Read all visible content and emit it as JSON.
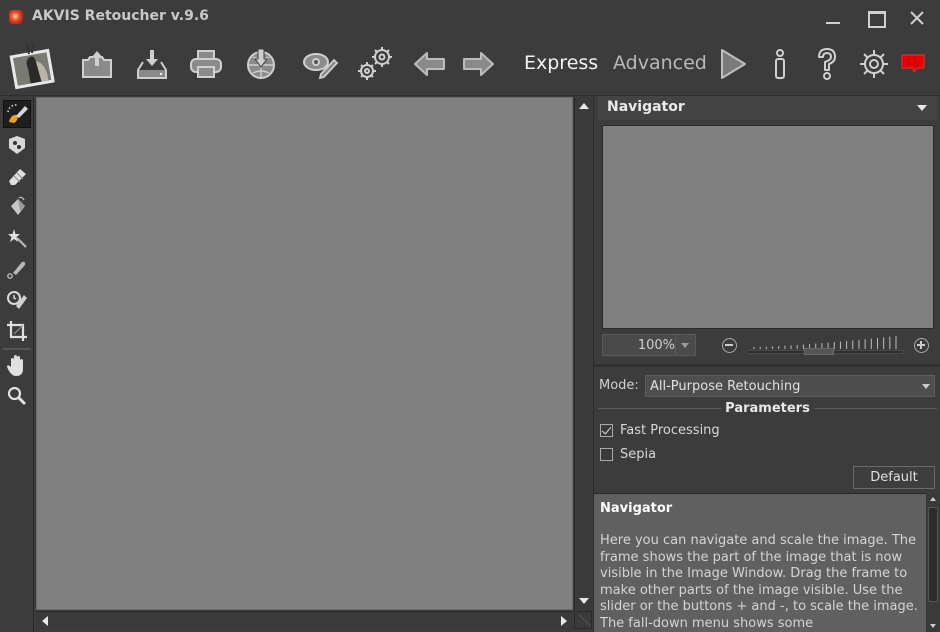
{
  "window": {
    "title": "AKVIS Retoucher v.9.6",
    "controls": {
      "minimize": "minimize-icon",
      "maximize": "maximize-icon",
      "close": "close-icon"
    }
  },
  "toolbar": {
    "buttons": [
      {
        "name": "photo-thumbnail",
        "icon": "photo-icon"
      },
      {
        "name": "open-image",
        "icon": "open-icon"
      },
      {
        "name": "save-image",
        "icon": "save-icon"
      },
      {
        "name": "print-image",
        "icon": "print-icon"
      },
      {
        "name": "share-image",
        "icon": "share-icon"
      },
      {
        "name": "batch-processing",
        "icon": "eye-pencil-icon"
      },
      {
        "name": "plugin-settings",
        "icon": "gears-icon"
      },
      {
        "name": "undo",
        "icon": "arrow-left-icon"
      },
      {
        "name": "redo",
        "icon": "arrow-right-icon"
      },
      {
        "name": "run",
        "icon": "play-icon"
      },
      {
        "name": "info",
        "icon": "info-icon"
      },
      {
        "name": "help",
        "icon": "question-icon"
      },
      {
        "name": "preferences",
        "icon": "gear-icon"
      },
      {
        "name": "notifications",
        "icon": "message-icon"
      }
    ],
    "modes": {
      "express": "Express",
      "advanced": "Advanced"
    },
    "colors": {
      "notification": "#e00000",
      "express_active": "#f2f2f2",
      "advanced_inactive": "#b8b8b8"
    }
  },
  "tools": [
    {
      "name": "retouch-tool",
      "icon": "retouch-brush-icon",
      "active": true
    },
    {
      "name": "clone-stamp-tool",
      "icon": "stamp-icon",
      "active": false
    },
    {
      "name": "eraser-tool",
      "icon": "eraser-icon",
      "active": false
    },
    {
      "name": "patch-tool",
      "icon": "bucket-icon",
      "active": false
    },
    {
      "name": "magic-wand-tool",
      "icon": "magic-wand-icon",
      "active": false
    },
    {
      "name": "chameleon-brush-tool",
      "icon": "chameleon-brush-icon",
      "active": false
    },
    {
      "name": "history-brush-tool",
      "icon": "history-brush-icon",
      "active": false
    },
    {
      "name": "crop-tool",
      "icon": "crop-icon",
      "active": false
    },
    {
      "name": "hand-tool",
      "icon": "hand-icon",
      "active": false
    },
    {
      "name": "zoom-tool",
      "icon": "magnifier-icon",
      "active": false
    }
  ],
  "navigator": {
    "title": "Navigator",
    "zoom_value": "100%",
    "zoom_slider_percent": 45
  },
  "settings": {
    "mode_label": "Mode:",
    "mode_value": "All-Purpose Retouching",
    "parameters_title": "Parameters",
    "checkboxes": [
      {
        "label": "Fast Processing",
        "checked": true
      },
      {
        "label": "Sepia",
        "checked": false
      }
    ],
    "default_button": "Default"
  },
  "help": {
    "title": "Navigator",
    "body": "Here you can navigate and scale the image. The frame shows the part of the image that is now visible in the Image Window. Drag the frame to make other parts of the image visible. Use the slider or the buttons + and -, to scale the image. The fall-down menu shows some"
  }
}
